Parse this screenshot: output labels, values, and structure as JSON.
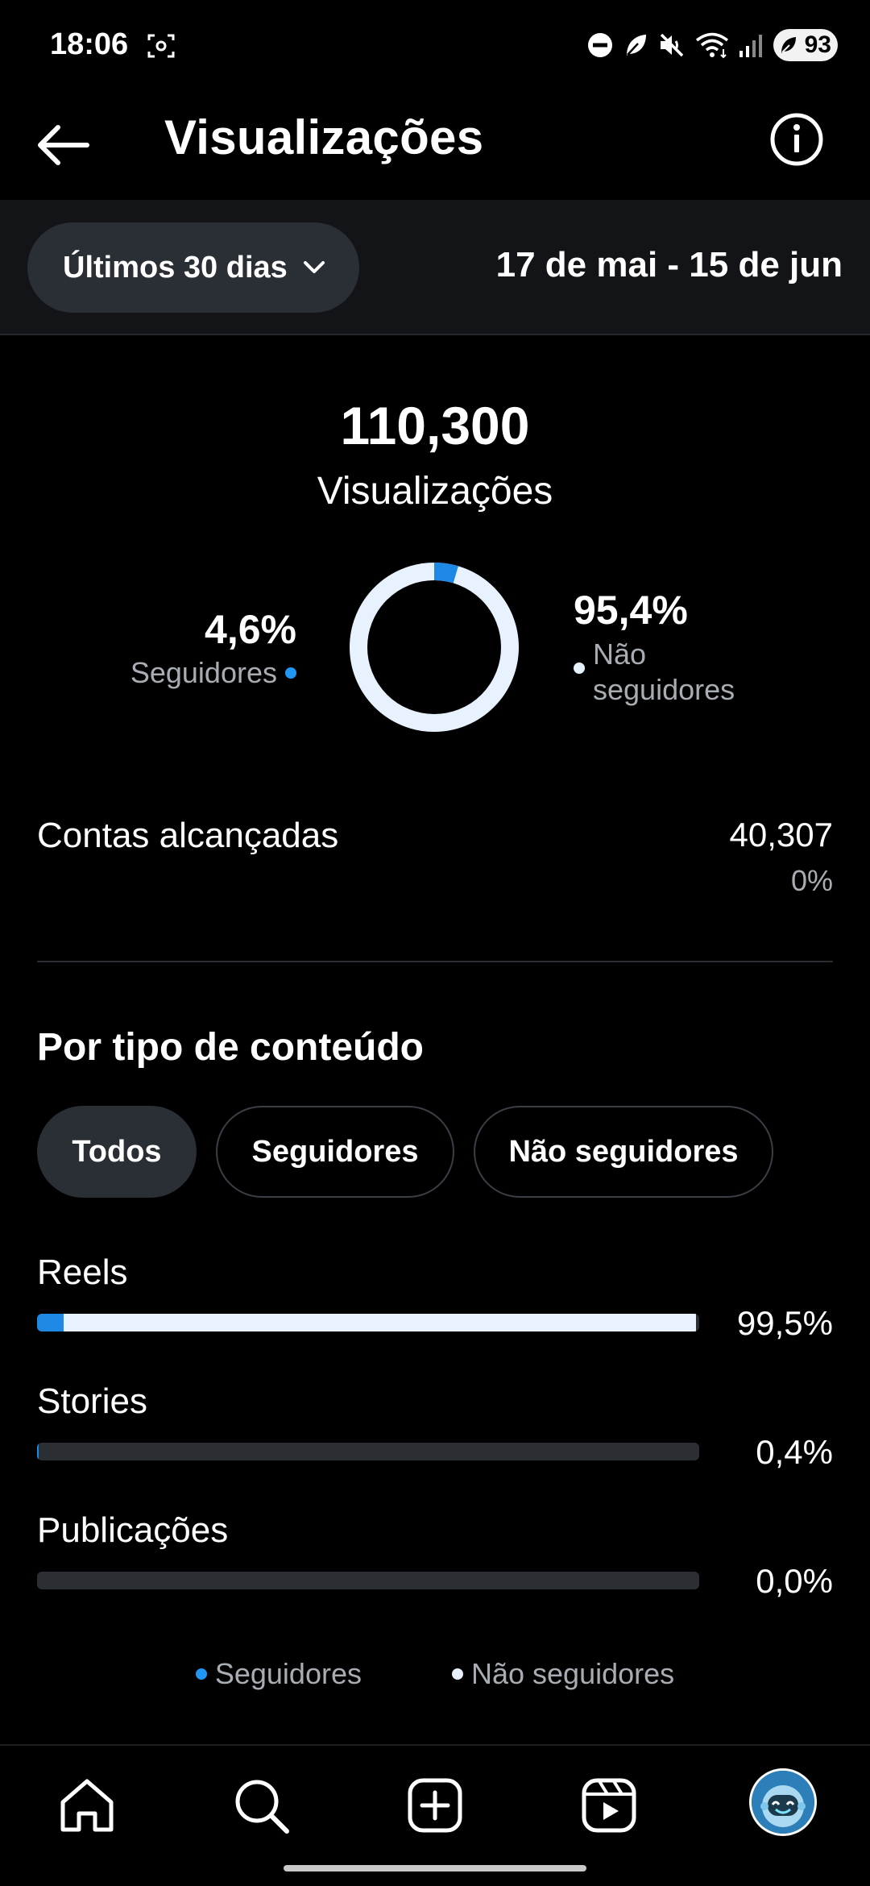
{
  "status_bar": {
    "time": "18:06",
    "battery": "93",
    "icons": [
      "screenshot-icon",
      "do-not-disturb-icon",
      "leaf-icon",
      "mute-icon",
      "wifi-icon",
      "signal-icon",
      "battery-icon"
    ]
  },
  "header": {
    "title": "Visualizações",
    "back_icon": "arrow-left-icon",
    "info_icon": "info-icon"
  },
  "filter": {
    "range_label": "Últimos 30 dias",
    "date_range": "17 de mai - 15 de jun"
  },
  "summary": {
    "total": "110,300",
    "total_label": "Visualizações",
    "followers_pct": "4,6%",
    "followers_label": "Seguidores",
    "followers_fraction": 0.046,
    "non_followers_pct": "95,4%",
    "non_followers_label": "Não seguidores"
  },
  "accounts": {
    "label": "Contas alcançadas",
    "value": "40,307",
    "change": "0%"
  },
  "content_type": {
    "title": "Por tipo de conteúdo",
    "filters": [
      "Todos",
      "Seguidores",
      "Não seguidores"
    ],
    "selected_filter": "Todos",
    "categories": [
      {
        "label": "Reels",
        "pct": "99,5%",
        "share": 0.995,
        "followers_share": 0.04
      },
      {
        "label": "Stories",
        "pct": "0,4%",
        "share": 0.004,
        "followers_share": 0.004
      },
      {
        "label": "Publicações",
        "pct": "0,0%",
        "share": 0.0,
        "followers_share": 0.0
      }
    ],
    "legend": [
      "Seguidores",
      "Não seguidores"
    ]
  },
  "colors": {
    "followers": "#1e88e5",
    "non_followers": "#e8f2ff",
    "background": "#000000",
    "band": "#121417"
  },
  "bottom_nav": [
    "home-icon",
    "search-icon",
    "create-icon",
    "reels-icon",
    "profile-avatar"
  ]
}
